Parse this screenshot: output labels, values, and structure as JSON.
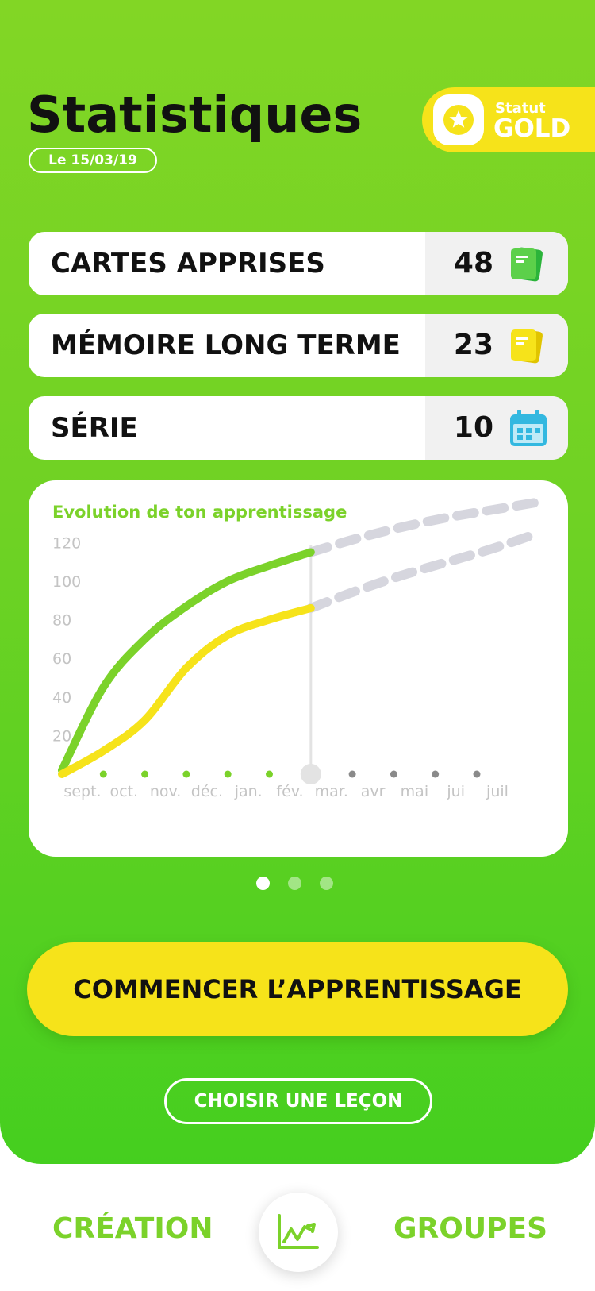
{
  "header": {
    "title": "Statistiques",
    "date": "Le 15/03/19",
    "status_small": "Statut",
    "status_big": "GOLD",
    "status_icon": "star-icon"
  },
  "stats": [
    {
      "label": "CARTES APPRISES",
      "value": "48",
      "icon": "green-cards-icon"
    },
    {
      "label": "MÉMOIRE LONG TERME",
      "value": "23",
      "icon": "yellow-cards-icon"
    },
    {
      "label": "SÉRIE",
      "value": "10",
      "icon": "calendar-icon"
    }
  ],
  "colors": {
    "green": "#7bd22a",
    "yellow": "#f6e31a",
    "projection": "#d6d6de"
  },
  "chart_data": {
    "type": "line",
    "title": "Evolution de ton apprentissage",
    "categories": [
      "sept.",
      "oct.",
      "nov.",
      "déc.",
      "jan.",
      "fév.",
      "mar.",
      "avr",
      "mai",
      "jui",
      "juil"
    ],
    "y_ticks": [
      "120",
      "100",
      "80",
      "60",
      "40",
      "20"
    ],
    "ylim": [
      0,
      130
    ],
    "current_index": 6,
    "series": [
      {
        "color": "#7bd22a",
        "values": [
          2,
          45,
          70,
          87,
          100,
          108,
          115
        ],
        "projection": [
          115,
          122,
          128,
          133,
          137,
          141
        ]
      },
      {
        "color": "#f6e31a",
        "values": [
          0,
          12,
          28,
          55,
          72,
          80,
          86
        ],
        "projection": [
          86,
          95,
          103,
          110,
          117,
          125
        ]
      }
    ]
  },
  "pager": {
    "count": 3,
    "active": 0
  },
  "actions": {
    "start": "COMMENCER L’APPRENTISSAGE",
    "choose": "CHOISIR UNE LEÇON"
  },
  "nav": {
    "left": "CRÉATION",
    "right": "GROUPES",
    "center_icon": "chart-icon"
  }
}
